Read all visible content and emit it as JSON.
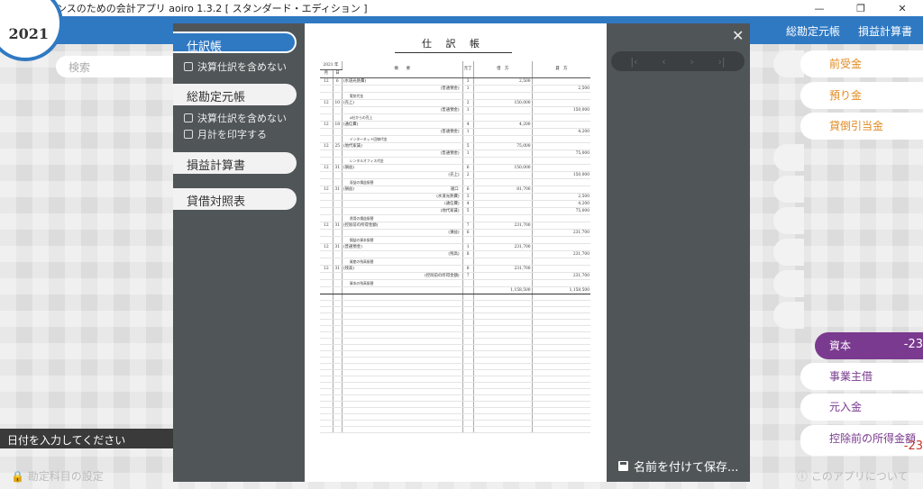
{
  "window": {
    "title": "フリーランスのための会計アプリ  aoiro 1.3.2  [ スタンダード・エディション ]",
    "minimize": "—",
    "maximize": "❐",
    "close": "✕"
  },
  "header": {
    "year": "2021",
    "nav": [
      "総勘定元帳",
      "損益計算書"
    ]
  },
  "search": {
    "placeholder": "検索"
  },
  "date_input": {
    "placeholder": "日付を入力してください"
  },
  "footer": {
    "left": "🔒 勘定科目の設定",
    "right": "ⓘ このアプリについて"
  },
  "accounts": [
    {
      "label": "前受金",
      "amount": ""
    },
    {
      "label": "預り金",
      "amount": ""
    },
    {
      "label": "貸倒引当金",
      "amount": ""
    },
    {
      "label": "資本",
      "amount": "-23"
    },
    {
      "label": "事業主借",
      "amount": ""
    },
    {
      "label": "元入金",
      "amount": ""
    },
    {
      "label": "控除前の所得金額",
      "amount": "-23"
    }
  ],
  "modal": {
    "close": "✕",
    "save_label": "名前を付けて保存...",
    "pager": [
      "|‹",
      "‹",
      "›",
      "›|"
    ],
    "sidebar": {
      "journal": "仕訳帳",
      "journal_opt": "決算仕訳を含めない",
      "general": "総勘定元帳",
      "general_opt1": "決算仕訳を含めない",
      "general_opt2": "月計を印字する",
      "pl": "損益計算書",
      "bs": "貸借対照表"
    },
    "doc": {
      "title": "仕 訳 帳",
      "headers": [
        "2021 年",
        "",
        "摘　　要",
        "元丁",
        "借　方",
        "貸　方"
      ],
      "subheaders": [
        "月",
        "日"
      ],
      "rows": [
        {
          "m": "12",
          "d": "6",
          "desc": "(水道光熱費)",
          "ref": "3",
          "dr": "2,500",
          "cr": "",
          "top": true
        },
        {
          "m": "",
          "d": "",
          "desc": "(普通預金)",
          "ref": "1",
          "dr": "",
          "cr": "2,500",
          "rt": true
        },
        {
          "m": "",
          "d": "",
          "desc": "電気代金",
          "ref": "",
          "dr": "",
          "cr": "",
          "memo": true
        },
        {
          "m": "12",
          "d": "10",
          "desc": "(売上)",
          "ref": "2",
          "dr": "150,000",
          "cr": "",
          "top": true
        },
        {
          "m": "",
          "d": "",
          "desc": "(普通預金)",
          "ref": "1",
          "dr": "",
          "cr": "150,000",
          "rt": true
        },
        {
          "m": "",
          "d": "",
          "desc": "A社からの売上",
          "ref": "",
          "dr": "",
          "cr": "",
          "memo": true
        },
        {
          "m": "12",
          "d": "18",
          "desc": "(通信費)",
          "ref": "4",
          "dr": "4,200",
          "cr": "",
          "top": true
        },
        {
          "m": "",
          "d": "",
          "desc": "(普通預金)",
          "ref": "1",
          "dr": "",
          "cr": "4,200",
          "rt": true
        },
        {
          "m": "",
          "d": "",
          "desc": "インターネット回線代金",
          "ref": "",
          "dr": "",
          "cr": "",
          "memo": true
        },
        {
          "m": "12",
          "d": "25",
          "desc": "(地代家賃)",
          "ref": "5",
          "dr": "75,000",
          "cr": "",
          "top": true
        },
        {
          "m": "",
          "d": "",
          "desc": "(普通預金)",
          "ref": "1",
          "dr": "",
          "cr": "75,000",
          "rt": true
        },
        {
          "m": "",
          "d": "",
          "desc": "レンタルオフィス代金",
          "ref": "",
          "dr": "",
          "cr": "",
          "memo": true
        },
        {
          "m": "12",
          "d": "31",
          "desc": "(損益)",
          "ref": "6",
          "dr": "150,000",
          "cr": "",
          "top": true
        },
        {
          "m": "",
          "d": "",
          "desc": "(売上)",
          "ref": "2",
          "dr": "",
          "cr": "150,000",
          "rt": true
        },
        {
          "m": "",
          "d": "",
          "desc": "収益の損益振替",
          "ref": "",
          "dr": "",
          "cr": "",
          "memo": true
        },
        {
          "m": "12",
          "d": "31",
          "desc": "(損益)",
          "ref": "6",
          "dr": "81,700",
          "cr": "",
          "top": true,
          "extra": "諸口"
        },
        {
          "m": "",
          "d": "",
          "desc": "(水道光熱費)",
          "ref": "3",
          "dr": "",
          "cr": "2,500",
          "rt": true
        },
        {
          "m": "",
          "d": "",
          "desc": "(通信費)",
          "ref": "4",
          "dr": "",
          "cr": "4,200",
          "rt": true
        },
        {
          "m": "",
          "d": "",
          "desc": "(地代家賃)",
          "ref": "5",
          "dr": "",
          "cr": "75,000",
          "rt": true
        },
        {
          "m": "",
          "d": "",
          "desc": "費用の損益振替",
          "ref": "",
          "dr": "",
          "cr": "",
          "memo": true
        },
        {
          "m": "12",
          "d": "31",
          "desc": "(控除前の所得金額)",
          "ref": "7",
          "dr": "231,700",
          "cr": "",
          "top": true
        },
        {
          "m": "",
          "d": "",
          "desc": "(損益)",
          "ref": "6",
          "dr": "",
          "cr": "231,700",
          "rt": true
        },
        {
          "m": "",
          "d": "",
          "desc": "損益の資本振替",
          "ref": "",
          "dr": "",
          "cr": "",
          "memo": true
        },
        {
          "m": "12",
          "d": "31",
          "desc": "(普通預金)",
          "ref": "1",
          "dr": "231,700",
          "cr": "",
          "top": true
        },
        {
          "m": "",
          "d": "",
          "desc": "(残高)",
          "ref": "8",
          "dr": "",
          "cr": "231,700",
          "rt": true
        },
        {
          "m": "",
          "d": "",
          "desc": "資産の残高振替",
          "ref": "",
          "dr": "",
          "cr": "",
          "memo": true
        },
        {
          "m": "12",
          "d": "31",
          "desc": "(残高)",
          "ref": "8",
          "dr": "231,700",
          "cr": "",
          "top": true
        },
        {
          "m": "",
          "d": "",
          "desc": "(控除前の所得金額)",
          "ref": "7",
          "dr": "",
          "cr": "231,700",
          "rt": true
        },
        {
          "m": "",
          "d": "",
          "desc": "資本の残高振替",
          "ref": "",
          "dr": "",
          "cr": "",
          "memo": true
        }
      ],
      "total_dr": "1,158,500",
      "total_cr": "1,158,500"
    }
  }
}
